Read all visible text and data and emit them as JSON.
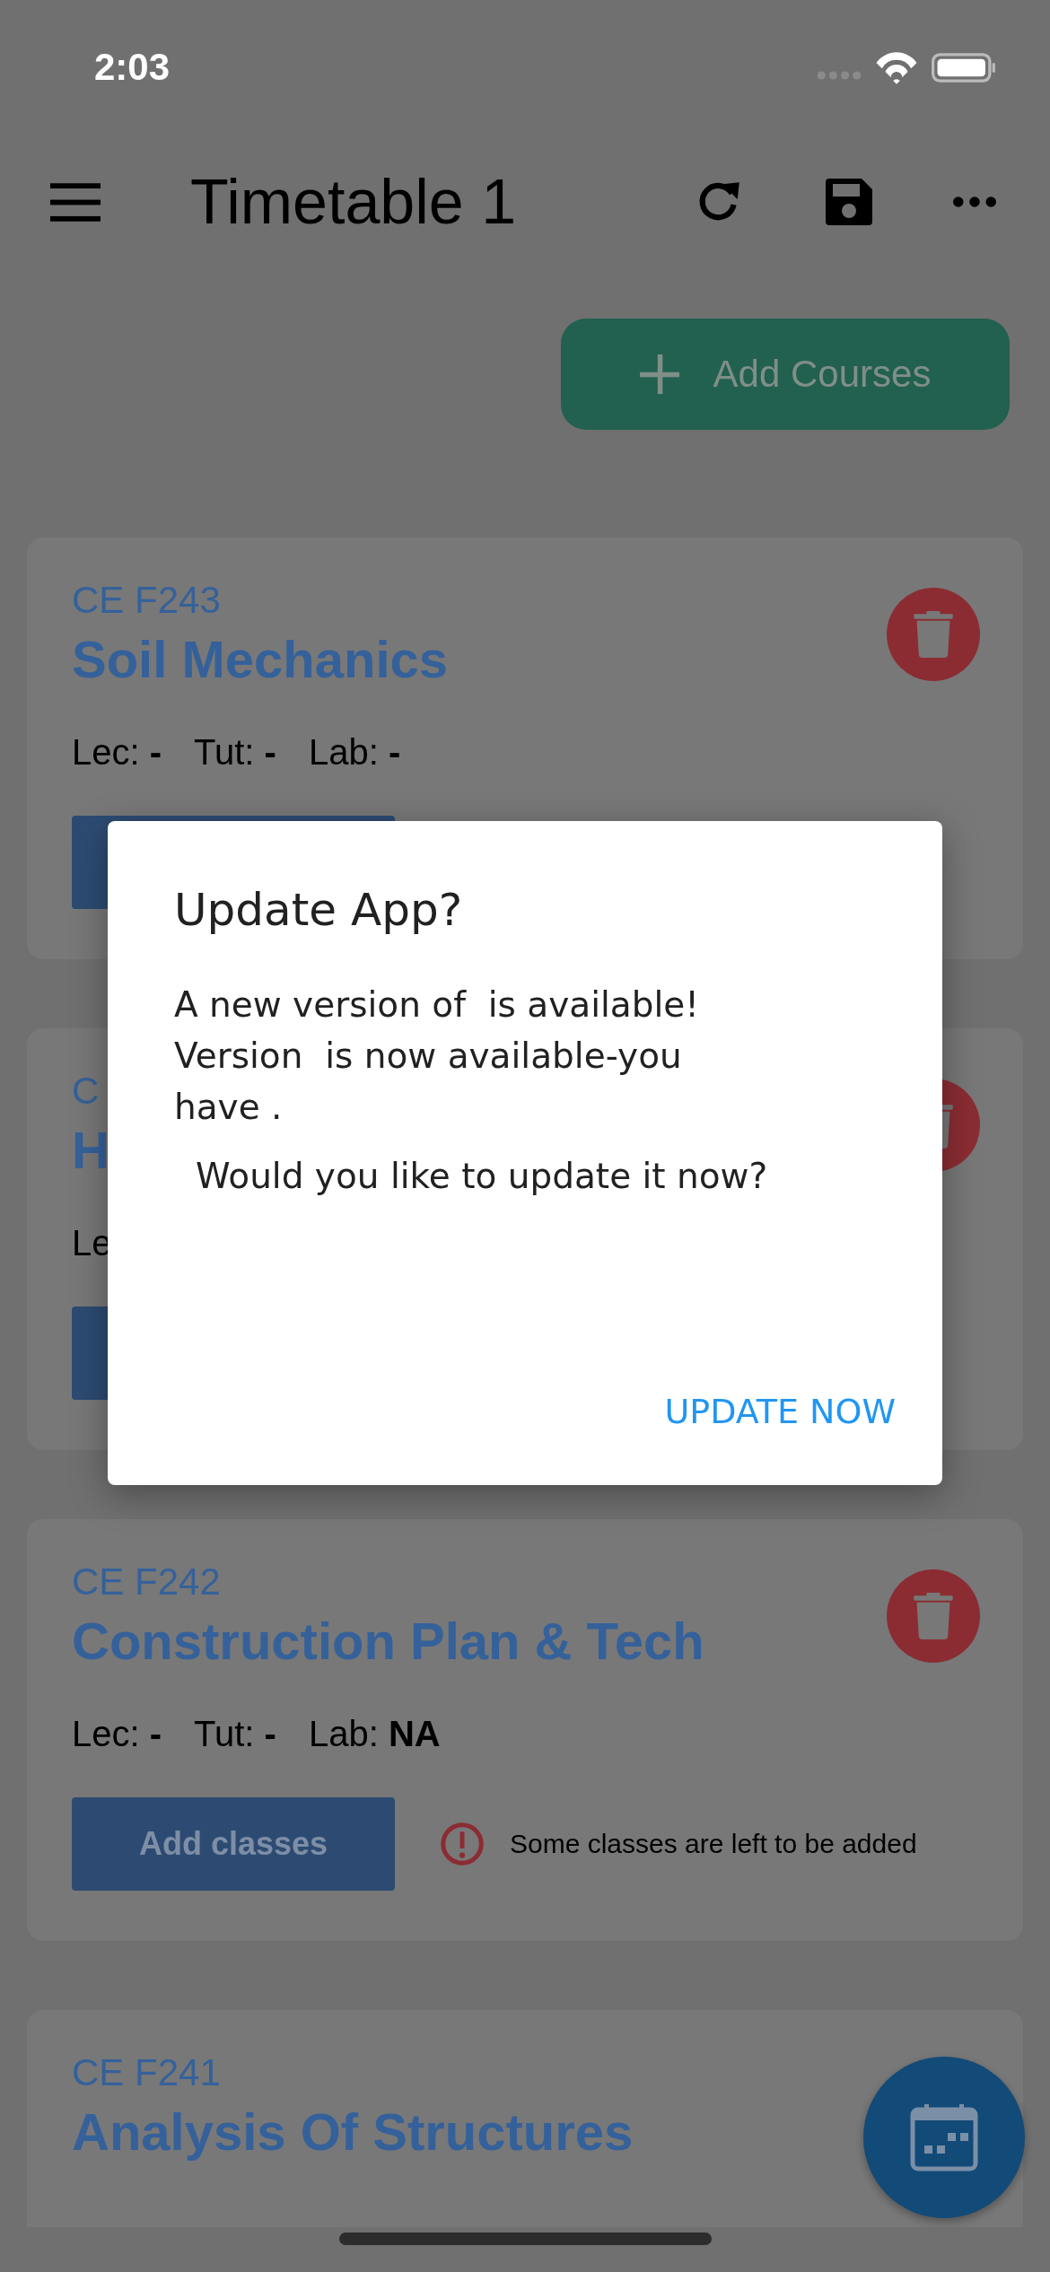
{
  "status_bar": {
    "time": "2:03"
  },
  "toolbar": {
    "title": "Timetable 1"
  },
  "add_courses_button": {
    "label": "Add Courses"
  },
  "courses": [
    {
      "code": "CE F243",
      "title": "Soil Mechanics",
      "deletable": true,
      "slots": [
        "Lec: **-**",
        "Tut: **-**",
        "Lab: **-**"
      ],
      "add_classes_button_shown": true
    },
    {
      "code": "C",
      "title": "H",
      "deletable": true,
      "slots": [
        "Le"
      ],
      "add_classes_button_shown": true
    },
    {
      "code": "CE F242",
      "title": "Construction Plan & Tech",
      "deletable": true,
      "slots": [
        "Lec: **-**",
        "Tut: **-**",
        "Lab: **NA**"
      ],
      "add_classes_button_shown": true,
      "add_classes_label": "Add classes",
      "warning": "Some classes are left to be added"
    },
    {
      "code": "CE F241",
      "title": "Analysis Of Structures",
      "deletable": false,
      "add_classes_button_shown": false
    }
  ],
  "dialog": {
    "title": "Update App?",
    "message": "A new version of  is available! Version  is now available-you have .",
    "question": "Would you like to update it now?",
    "button": "UPDATE NOW"
  }
}
